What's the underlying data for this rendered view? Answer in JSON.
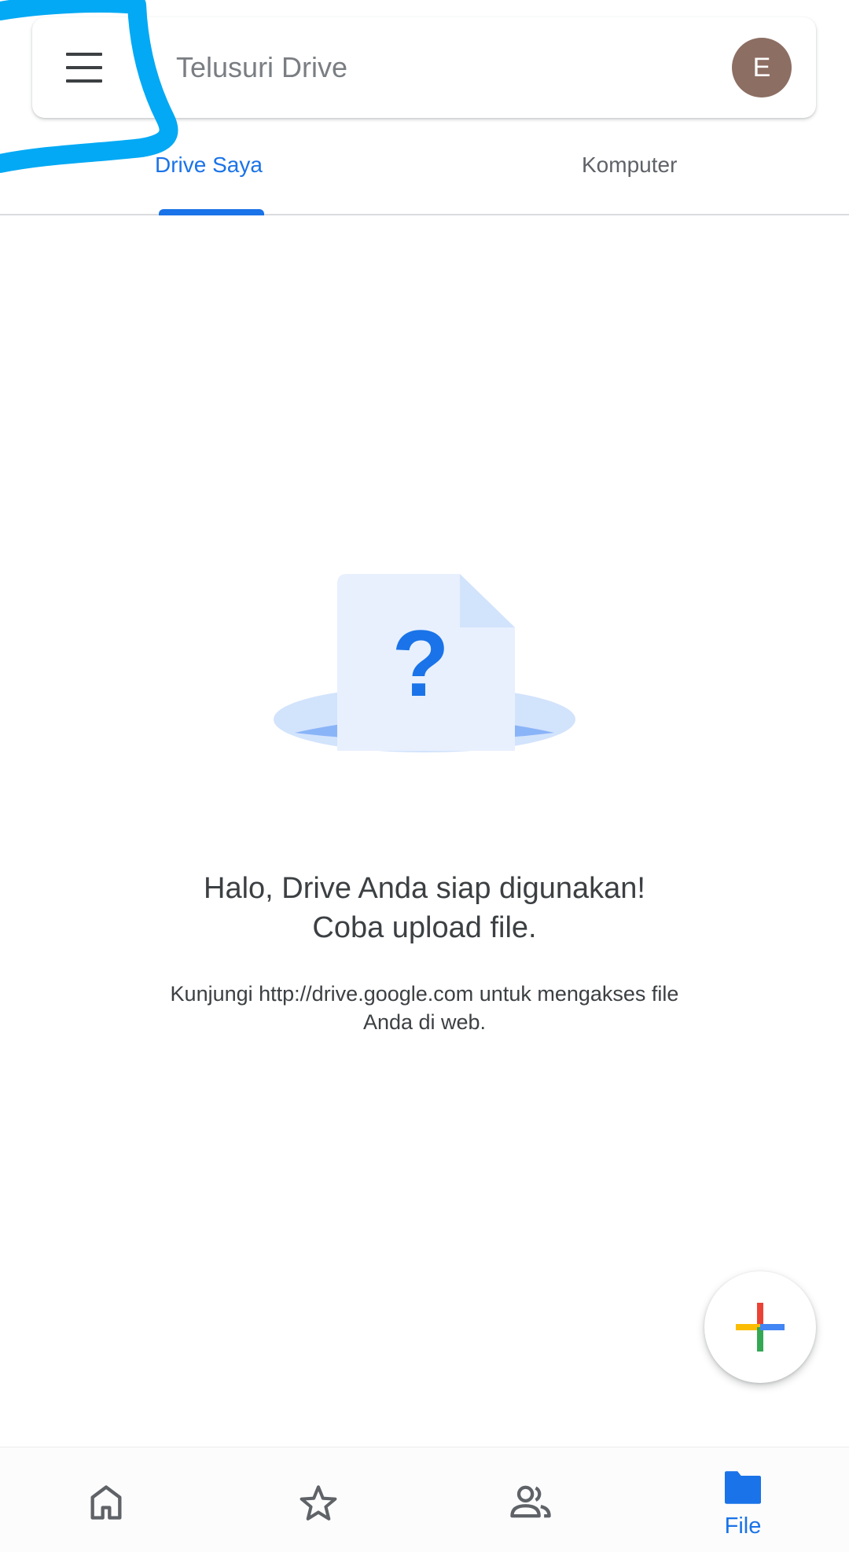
{
  "search": {
    "placeholder": "Telusuri Drive",
    "avatar_letter": "E",
    "avatar_color": "#8d6e63",
    "menu_icon": "menu-icon"
  },
  "tabs": [
    {
      "label": "Drive Saya",
      "active": true
    },
    {
      "label": "Komputer",
      "active": false
    }
  ],
  "empty_state": {
    "title_line1": "Halo, Drive Anda siap digunakan!",
    "title_line2": "Coba upload file.",
    "subtitle_line1": "Kunjungi http://drive.google.com untuk mengakses file",
    "subtitle_line2": "Anda di web.",
    "illustration_icon": "question-document-icon"
  },
  "fab": {
    "icon": "plus-icon",
    "colors": [
      "#ea4335",
      "#fbbc04",
      "#34a853",
      "#4285f4"
    ]
  },
  "bottom_nav": {
    "items": [
      {
        "icon": "home-icon",
        "label": "",
        "active": false
      },
      {
        "icon": "star-icon",
        "label": "",
        "active": false
      },
      {
        "icon": "shared-icon",
        "label": "",
        "active": false
      },
      {
        "icon": "folder-icon",
        "label": "File",
        "active": true
      }
    ]
  },
  "colors": {
    "accent": "#1a73e8",
    "text": "#3c4043",
    "muted": "#5f6368",
    "annotation": "#03a9f4"
  }
}
